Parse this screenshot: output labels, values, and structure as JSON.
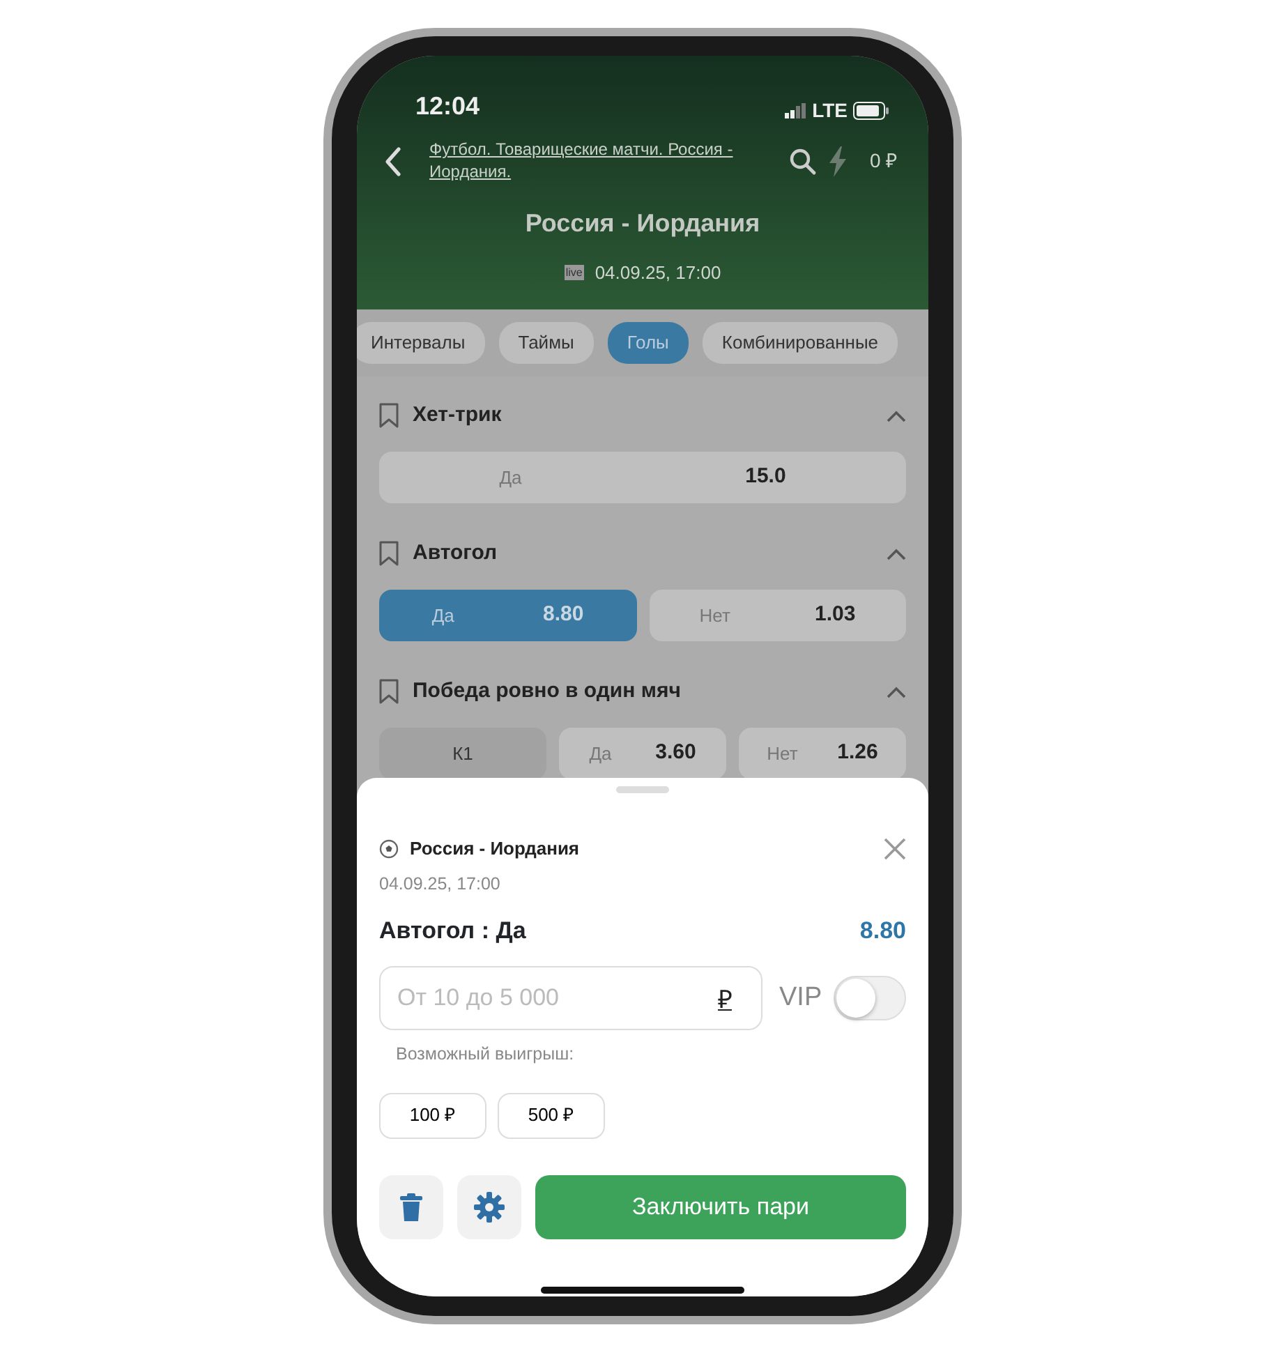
{
  "status_bar": {
    "time": "12:04",
    "network": "LTE"
  },
  "header": {
    "breadcrumb": "Футбол. Товарищеские матчи. Россия - Иордания.",
    "balance": "0 ₽",
    "title": "Россия - Иордания",
    "live_badge": "live",
    "datetime": "04.09.25, 17:00"
  },
  "tabs": [
    {
      "label": "Интервалы",
      "selected": false
    },
    {
      "label": "Таймы",
      "selected": false
    },
    {
      "label": "Голы",
      "selected": true
    },
    {
      "label": "Комбинированные",
      "selected": false
    }
  ],
  "markets": [
    {
      "title": "Хет-трик",
      "expanded": true,
      "outcomes": [
        {
          "kind": "odds",
          "label": "Да",
          "odds": "15.0",
          "selected": false
        }
      ]
    },
    {
      "title": "Автогол",
      "expanded": true,
      "outcomes": [
        {
          "kind": "odds",
          "label": "Да",
          "odds": "8.80",
          "selected": true
        },
        {
          "kind": "odds",
          "label": "Нет",
          "odds": "1.03",
          "selected": false
        }
      ]
    },
    {
      "title": "Победа ровно в один мяч",
      "expanded": true,
      "outcomes": [
        {
          "kind": "team",
          "label": "К1"
        },
        {
          "kind": "odds",
          "label": "Да",
          "odds": "3.60",
          "selected": false
        },
        {
          "kind": "odds",
          "label": "Нет",
          "odds": "1.26",
          "selected": false
        }
      ]
    }
  ],
  "bet_slip": {
    "match": "Россия - Иордания",
    "datetime": "04.09.25, 17:00",
    "bet": "Автогол : Да",
    "odds": "8.80",
    "stake_placeholder": "От 10 до 5 000",
    "currency": "₽",
    "vip_label": "VIP",
    "vip_on": false,
    "win_label": "Возможный выигрыш:",
    "quick_amounts": [
      "100 ₽",
      "500 ₽"
    ],
    "submit": "Заключить пари"
  }
}
